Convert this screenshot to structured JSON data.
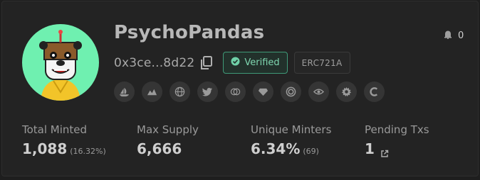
{
  "collection": {
    "name": "PsychoPandas",
    "address": "0x3ce...8d22",
    "verified_label": "Verified",
    "standard": "ERC721A",
    "watchers": "0"
  },
  "social_icons": [
    "opensea-icon",
    "looksrare-icon",
    "website-icon",
    "twitter-icon",
    "x2y2-icon",
    "diamond-icon",
    "target-icon",
    "eye-icon",
    "gear-icon",
    "c-logo-icon"
  ],
  "stats": {
    "total_minted": {
      "label": "Total Minted",
      "value": "1,088",
      "sub": "(16.32%)"
    },
    "max_supply": {
      "label": "Max Supply",
      "value": "6,666"
    },
    "unique_minters": {
      "label": "Unique Minters",
      "value": "6.34%",
      "sub": "(69)"
    },
    "pending_txs": {
      "label": "Pending Txs",
      "value": "1"
    }
  },
  "colors": {
    "background": "#232323",
    "avatar_bg": "#6ff0b0",
    "verified_accent": "#3f9a78",
    "icon_bg": "#353535"
  }
}
